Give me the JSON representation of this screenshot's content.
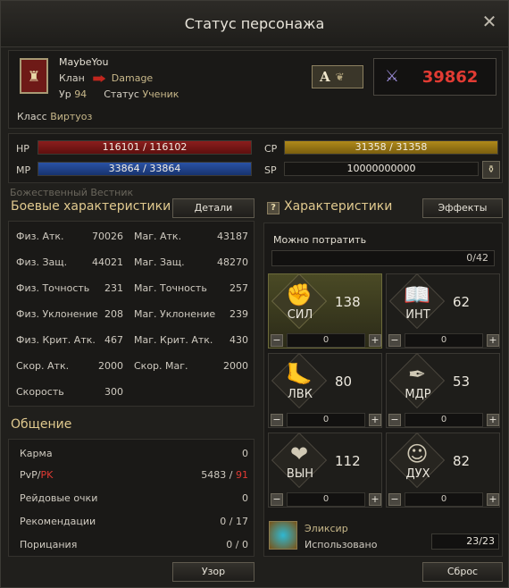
{
  "window": {
    "title": "Статус персонажа"
  },
  "profile": {
    "name": "MaybeYou",
    "clan_label": "Клан",
    "clan_value": "Damage",
    "level_label": "Ур",
    "level_value": "94",
    "status_label": "Статус",
    "status_value": "Ученик",
    "class_label": "Класс",
    "class_value": "Виртуоз",
    "grade": "A",
    "combat_power": "39862",
    "colors": {
      "power": "#e23b33"
    }
  },
  "bars": {
    "hp_label": "HP",
    "hp_value": "116101 / 116102",
    "hp_fill": 0.99999,
    "mp_label": "MP",
    "mp_value": "33864 / 33864",
    "mp_fill": 1.0,
    "cp_label": "CP",
    "cp_value": "31358 / 31358",
    "cp_fill": 1.0,
    "sp_label": "SP",
    "sp_value": "10000000000"
  },
  "ghost_text": "Божественный Вестник",
  "combat": {
    "title": "Боевые характеристики",
    "details_button": "Детали",
    "rows": [
      {
        "k1": "Физ. Атк.",
        "v1": "70026",
        "k2": "Маг. Атк.",
        "v2": "43187"
      },
      {
        "k1": "Физ. Защ.",
        "v1": "44021",
        "k2": "Маг. Защ.",
        "v2": "48270"
      },
      {
        "k1": "Физ. Точность",
        "v1": "231",
        "k2": "Маг. Точность",
        "v2": "257"
      },
      {
        "k1": "Физ. Уклонение",
        "v1": "208",
        "k2": "Маг. Уклонение",
        "v2": "239"
      },
      {
        "k1": "Физ. Крит. Атк.",
        "v1": "467",
        "k2": "Маг. Крит. Атк.",
        "v2": "430"
      },
      {
        "k1": "Скор. Атк.",
        "v1": "2000",
        "k2": "Скор. Маг.",
        "v2": "2000"
      },
      {
        "k1": "Скорость",
        "v1": "300",
        "k2": "",
        "v2": ""
      }
    ]
  },
  "social": {
    "title": "Общение",
    "karma_label": "Карма",
    "karma_value": "0",
    "pvp_label": "PvP/",
    "pk_label": "PK",
    "pvp_value": "5483 / ",
    "pk_value": "91",
    "raid_label": "Рейдовые очки",
    "raid_value": "0",
    "rec_label": "Рекомендации",
    "rec_value": "0 / 17",
    "cens_label": "Порицания",
    "cens_value": "0 / 0"
  },
  "attributes": {
    "title": "Характеристики",
    "effects_button": "Эффекты",
    "spend_label": "Можно потратить",
    "spend_value": "0/42",
    "items": [
      {
        "name": "СИЛ",
        "value": "138",
        "alloc": "0",
        "icon": "fist-icon"
      },
      {
        "name": "ИНТ",
        "value": "62",
        "alloc": "0",
        "icon": "book-icon"
      },
      {
        "name": "ЛВК",
        "value": "80",
        "alloc": "0",
        "icon": "foot-icon"
      },
      {
        "name": "МДР",
        "value": "53",
        "alloc": "0",
        "icon": "feather-icon"
      },
      {
        "name": "ВЫН",
        "value": "112",
        "alloc": "0",
        "icon": "heart-icon"
      },
      {
        "name": "ДУХ",
        "value": "82",
        "alloc": "0",
        "icon": "head-icon"
      }
    ],
    "minus": "−",
    "plus": "+"
  },
  "elixir": {
    "name": "Эликсир",
    "used_label": "Использовано",
    "used_value": "23/23"
  },
  "footer": {
    "pattern_button": "Узор",
    "reset_button": "Сброс"
  }
}
